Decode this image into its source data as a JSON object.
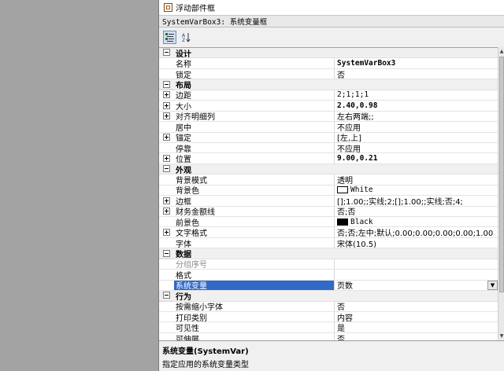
{
  "tree": {
    "item_label": "浮动部件框"
  },
  "selector": {
    "label": "SystemVarBox3: 系统变量框"
  },
  "toolbar": {
    "categorized_tip": "按分类",
    "alpha_tip": "按字母"
  },
  "properties": [
    {
      "type": "category",
      "name": "设计"
    },
    {
      "type": "prop",
      "name": "名称",
      "value": "SystemVarBox3",
      "bold": true,
      "mono": true
    },
    {
      "type": "prop",
      "name": "锁定",
      "value": "否"
    },
    {
      "type": "category",
      "name": "布局"
    },
    {
      "type": "prop",
      "name": "边距",
      "value": "2;1;1;1",
      "expand": true,
      "mono": true
    },
    {
      "type": "prop",
      "name": "大小",
      "value": "2.40,0.98",
      "expand": true,
      "bold": true,
      "mono": true
    },
    {
      "type": "prop",
      "name": "对齐明细列",
      "value": "左右两端;;",
      "expand": true
    },
    {
      "type": "prop",
      "name": "居中",
      "value": "不应用"
    },
    {
      "type": "prop",
      "name": "锚定",
      "value": "[左,上]",
      "expand": true
    },
    {
      "type": "prop",
      "name": "停靠",
      "value": "不应用"
    },
    {
      "type": "prop",
      "name": "位置",
      "value": "9.00,0.21",
      "expand": true,
      "bold": true,
      "mono": true
    },
    {
      "type": "category",
      "name": "外观"
    },
    {
      "type": "prop",
      "name": "背景模式",
      "value": "透明"
    },
    {
      "type": "prop",
      "name": "背景色",
      "value": "White",
      "swatch": "#ffffff",
      "mono": true
    },
    {
      "type": "prop",
      "name": "边框",
      "value": "[];1.00;;实线;2;[];1.00;;实线;否;4;",
      "expand": true
    },
    {
      "type": "prop",
      "name": "财务金额线",
      "value": "否;否",
      "expand": true
    },
    {
      "type": "prop",
      "name": "前景色",
      "value": "Black",
      "swatch": "#000000",
      "mono": true
    },
    {
      "type": "prop",
      "name": "文字格式",
      "value": "否;否;左中;默认;0.00;0.00;0.00;0.00;1.00",
      "expand": true
    },
    {
      "type": "prop",
      "name": "字体",
      "value": "宋体(10.5)"
    },
    {
      "type": "category",
      "name": "数据"
    },
    {
      "type": "prop",
      "name": "分组序号",
      "value": "",
      "grey": true
    },
    {
      "type": "prop",
      "name": "格式",
      "value": ""
    },
    {
      "type": "prop",
      "name": "系统变量",
      "value": "页数",
      "selected": true,
      "dropdown": true
    },
    {
      "type": "category",
      "name": "行为"
    },
    {
      "type": "prop",
      "name": "按需缩小字体",
      "value": "否"
    },
    {
      "type": "prop",
      "name": "打印类别",
      "value": "内容"
    },
    {
      "type": "prop",
      "name": "可见性",
      "value": "是"
    },
    {
      "type": "prop",
      "name": "可伸展",
      "value": "否"
    }
  ],
  "description": {
    "title": "系统变量(SystemVar)",
    "text": "指定应用的系统变量类型"
  },
  "icons": {
    "tree_item": "frame-icon",
    "categorized": "categorized-icon",
    "alphabetical": "sort-az-icon",
    "dropdown": "chevron-down-icon"
  }
}
